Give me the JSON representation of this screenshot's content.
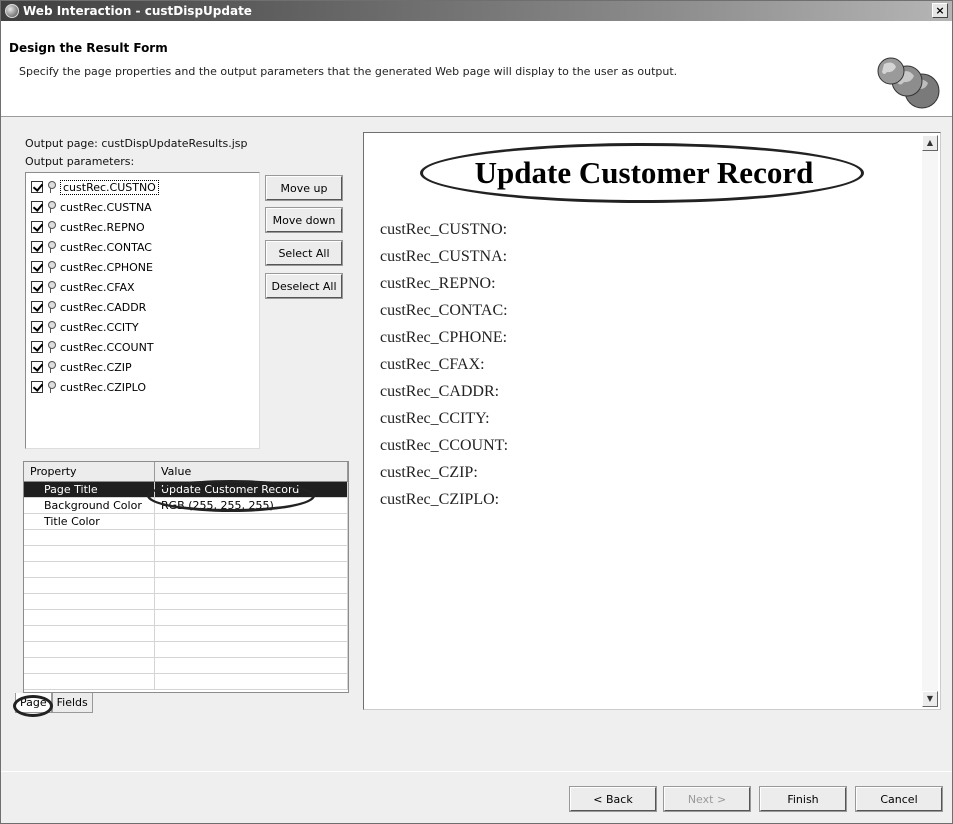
{
  "window": {
    "title": "Web Interaction - custDispUpdate",
    "close_label": "×"
  },
  "header": {
    "title": "Design the Result Form",
    "description": "Specify the page properties and the output parameters that the generated Web page will display to the user as output."
  },
  "output_page_label": "Output page: custDispUpdateResults.jsp",
  "output_params_label": "Output parameters:",
  "params": [
    "custRec.CUSTNO",
    "custRec.CUSTNA",
    "custRec.REPNO",
    "custRec.CONTAC",
    "custRec.CPHONE",
    "custRec.CFAX",
    "custRec.CADDR",
    "custRec.CCITY",
    "custRec.CCOUNT",
    "custRec.CZIP",
    "custRec.CZIPLO"
  ],
  "buttons": {
    "move_up": "Move up",
    "move_down": "Move down",
    "select_all": "Select All",
    "deselect_all": "Deselect All"
  },
  "properties": {
    "header": [
      "Property",
      "Value"
    ],
    "rows": [
      [
        "Page Title",
        "Update Customer Record"
      ],
      [
        "Background Color",
        "RGB (255, 255, 255)"
      ],
      [
        "Title Color",
        ""
      ]
    ]
  },
  "tabs": [
    "Page",
    "Fields"
  ],
  "preview": {
    "title": "Update Customer Record",
    "fields": [
      "custRec_CUSTNO:",
      "custRec_CUSTNA:",
      "custRec_REPNO:",
      "custRec_CONTAC:",
      "custRec_CPHONE:",
      "custRec_CFAX:",
      "custRec_CADDR:",
      "custRec_CCITY:",
      "custRec_CCOUNT:",
      "custRec_CZIP:",
      "custRec_CZIPLO:"
    ]
  },
  "footer": {
    "back": "< Back",
    "next": "Next >",
    "finish": "Finish",
    "cancel": "Cancel"
  }
}
